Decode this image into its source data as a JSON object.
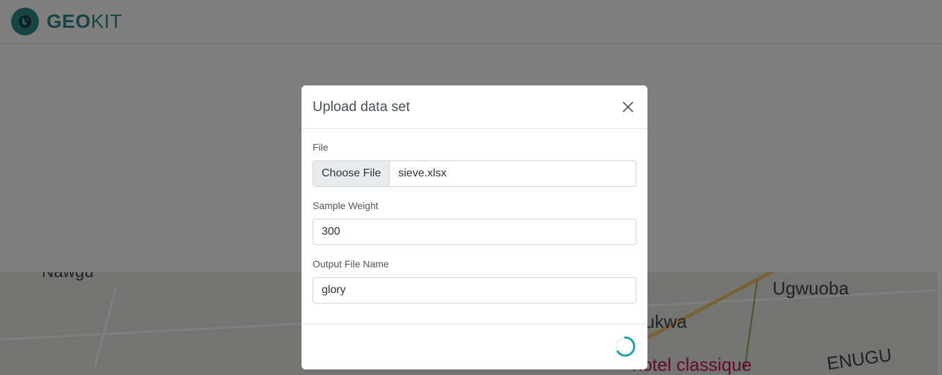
{
  "app": {
    "logo_bold": "GEO",
    "logo_light": "KIT"
  },
  "map": {
    "labels": [
      "Nawgu",
      "Ugwuoba",
      "kukwa",
      "hotel classique",
      "ENUGU"
    ]
  },
  "modal": {
    "title": "Upload data set",
    "file": {
      "label": "File",
      "button_label": "Choose File",
      "file_name": "sieve.xlsx"
    },
    "sample_weight": {
      "label": "Sample Weight",
      "value": "300"
    },
    "output_file_name": {
      "label": "Output File Name",
      "value": "glory"
    },
    "footer": {
      "status": "loading"
    }
  },
  "colors": {
    "brand": "#2e8a8a",
    "spinner": "#17a2b8",
    "backdrop": "rgba(0,0,0,0.5)"
  },
  "icons": {
    "logo": "globe-icon",
    "close": "close-icon",
    "spinner": "loading-spinner-icon"
  }
}
